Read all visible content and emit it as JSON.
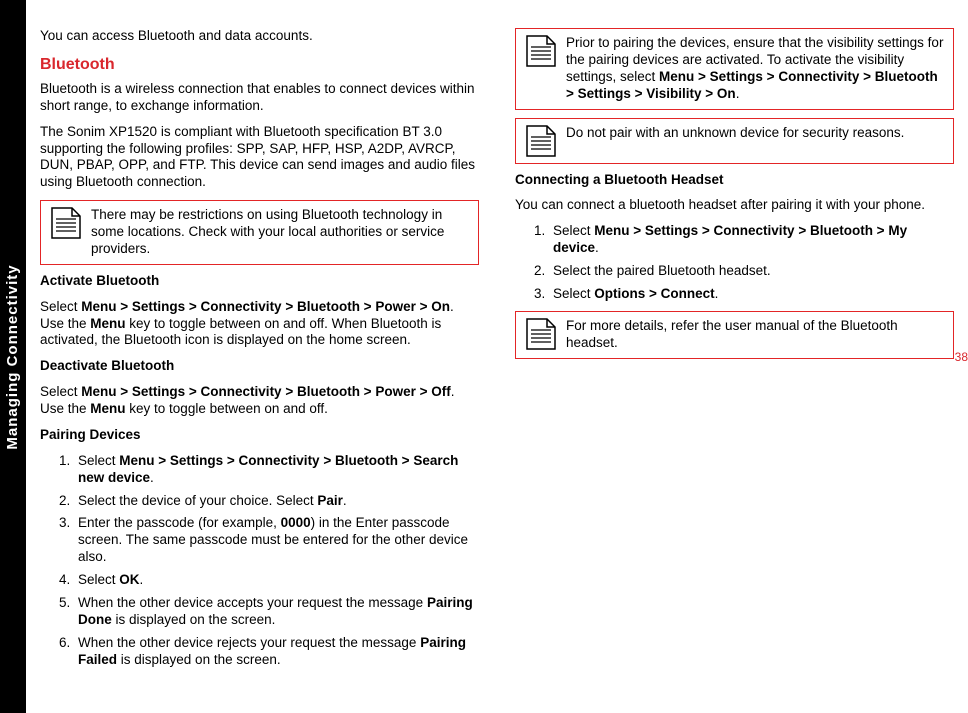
{
  "sideLabel": "Managing Connectivity",
  "pageNumber": "38",
  "intro": "You can access Bluetooth and data accounts.",
  "h_bluetooth": "Bluetooth",
  "p_bt_intro": "Bluetooth is a wireless connection that enables to connect devices within short range, to exchange information.",
  "p_bt_spec": "The Sonim XP1520 is compliant with Bluetooth specification BT 3.0 supporting the following profiles: SPP, SAP, HFP, HSP, A2DP, AVRCP, DUN, PBAP, OPP, and FTP. This device can send images and audio files using Bluetooth connection.",
  "note1": "There may be restrictions on using Bluetooth technology in some locations. Check with your local authorities or service providers.",
  "h_activate": "Activate Bluetooth",
  "p_activate_a": "Select ",
  "p_activate_b": "Menu > Settings > Connectivity > Bluetooth  > Power > On",
  "p_activate_c": ". Use the ",
  "p_activate_d": "Menu",
  "p_activate_e": " key to toggle between on and off. When Bluetooth is activated, the Bluetooth icon is displayed on the home screen.",
  "h_deactivate": "Deactivate Bluetooth",
  "p_deactivate_a": "Select ",
  "p_deactivate_b": "Menu > Settings > Connectivity > Bluetooth > Power > Off",
  "p_deactivate_c": ". Use the ",
  "p_deactivate_d": "Menu",
  "p_deactivate_e": " key to toggle between on and off.",
  "h_pairing": "Pairing Devices",
  "pair1_a": "Select ",
  "pair1_b": "Menu > Settings > Connectivity > Bluetooth > Search new device",
  "pair1_c": ".",
  "pair2_a": "Select the device of your choice. Select ",
  "pair2_b": "Pair",
  "pair2_c": ".",
  "pair3_a": "Enter the passcode (for example, ",
  "pair3_b": "0000",
  "pair3_c": ") in the Enter passcode screen. The same passcode must be entered for the other device also.",
  "pair4_a": "Select ",
  "pair4_b": "OK",
  "pair4_c": ".",
  "pair5_a": "When the other device accepts your request the message ",
  "pair5_b": "Pairing Done",
  "pair5_c": " is displayed on the screen.",
  "pair6_a": "When the other device rejects your request the message ",
  "pair6_b": "Pairing Failed",
  "pair6_c": " is displayed on the screen.",
  "note2_a": "Prior to pairing the devices, ensure that the visibility settings for the pairing devices are activated. To activate the visibility settings, select ",
  "note2_b": "Menu > Settings > Connectivity > Bluetooth > Settings > Visibility > On",
  "note2_c": ".",
  "note3": "Do not pair with an unknown device for security reasons.",
  "h_headset": "Connecting a Bluetooth Headset",
  "p_headset": "You can connect a bluetooth headset after pairing it with your phone.",
  "hs1_a": "Select ",
  "hs1_b": "Menu > Settings > Connectivity > Bluetooth > My device",
  "hs1_c": ".",
  "hs2": "Select the paired Bluetooth headset.",
  "hs3_a": "Select ",
  "hs3_b": "Options > Connect",
  "hs3_c": ".",
  "note4": "For more details, refer the user manual of the Bluetooth headset."
}
